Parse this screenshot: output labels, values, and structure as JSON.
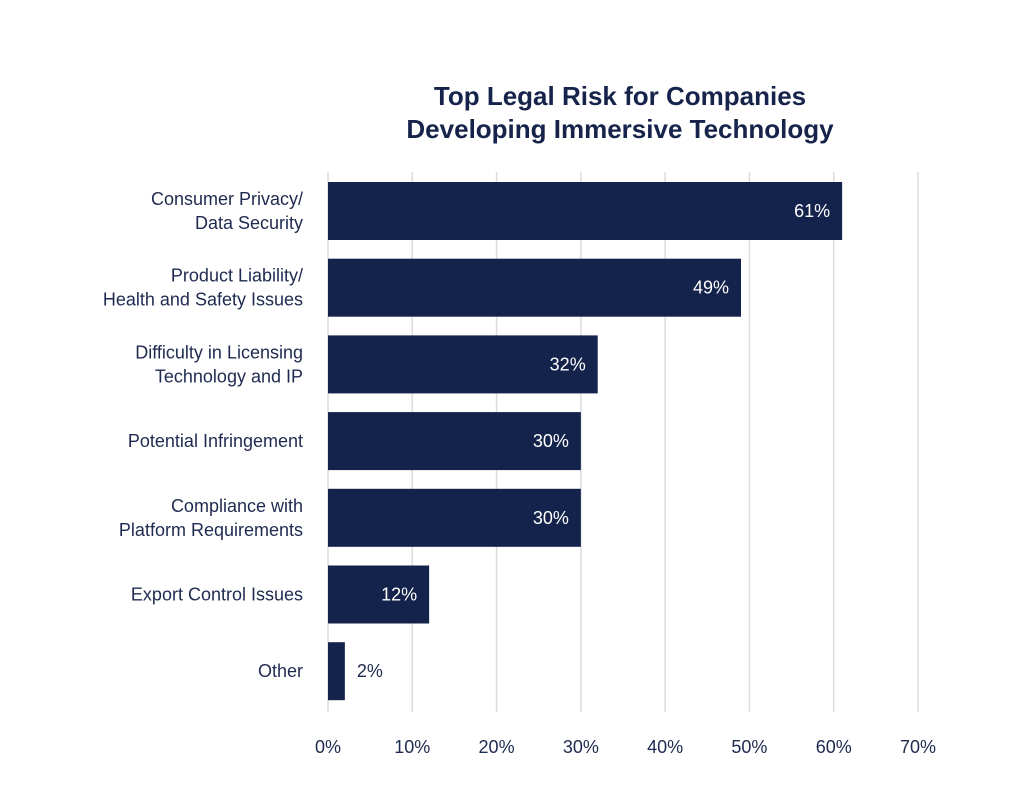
{
  "chart_data": {
    "type": "bar",
    "orientation": "horizontal",
    "title": "Top Legal Risk for Companies Developing Immersive Technology",
    "title_lines": [
      "Top Legal Risk for Companies",
      "Developing Immersive Technology"
    ],
    "categories": [
      [
        "Consumer Privacy/",
        "Data Security"
      ],
      [
        "Product Liability/",
        "Health and Safety Issues"
      ],
      [
        "Difficulty in Licensing",
        "Technology and IP"
      ],
      [
        "Potential Infringement"
      ],
      [
        "Compliance with",
        "Platform Requirements"
      ],
      [
        "Export Control Issues"
      ],
      [
        "Other"
      ]
    ],
    "values": [
      61,
      49,
      32,
      30,
      30,
      12,
      2
    ],
    "value_labels": [
      "61%",
      "49%",
      "32%",
      "30%",
      "30%",
      "12%",
      "2%"
    ],
    "xlabel": "",
    "ylabel": "",
    "xlim": [
      0,
      70
    ],
    "xticks": [
      0,
      10,
      20,
      30,
      40,
      50,
      60,
      70
    ],
    "xtick_labels": [
      "0%",
      "10%",
      "20%",
      "30%",
      "40%",
      "50%",
      "60%",
      "70%"
    ],
    "grid": true,
    "legend": "none",
    "colors": {
      "bar": "#14234b",
      "grid": "#dcdcdc",
      "text": "#1e2a4f"
    }
  }
}
